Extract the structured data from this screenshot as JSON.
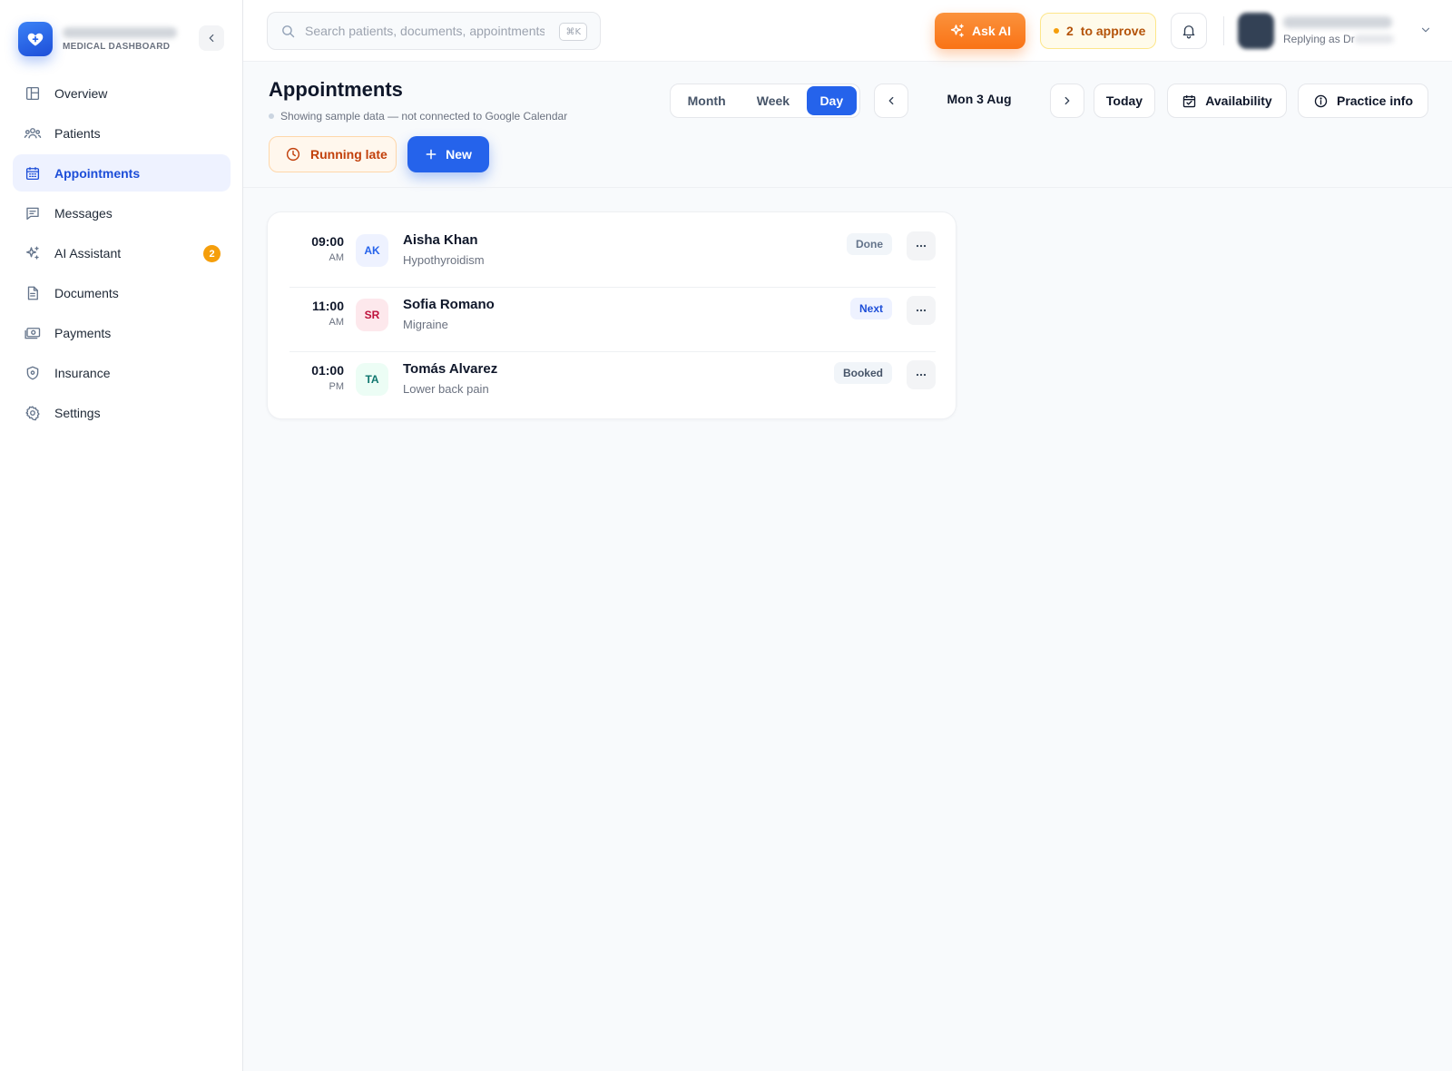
{
  "brand": {
    "subtitle": "MEDICAL DASHBOARD",
    "logo_icon": "heart-plus-icon",
    "accent": "#2563eb"
  },
  "sidebar": {
    "items": [
      {
        "label": "Overview",
        "icon": "layout-icon",
        "active": false
      },
      {
        "label": "Patients",
        "icon": "users-icon",
        "active": false
      },
      {
        "label": "Appointments",
        "icon": "calendar-icon",
        "active": true
      },
      {
        "label": "Messages",
        "icon": "message-icon",
        "active": false
      },
      {
        "label": "AI Assistant",
        "icon": "sparkles-icon",
        "active": false,
        "badge": "2"
      },
      {
        "label": "Documents",
        "icon": "document-icon",
        "active": false
      },
      {
        "label": "Payments",
        "icon": "cash-icon",
        "active": false
      },
      {
        "label": "Insurance",
        "icon": "shield-icon",
        "active": false
      },
      {
        "label": "Settings",
        "icon": "gear-icon",
        "active": false
      }
    ]
  },
  "topbar": {
    "search_placeholder": "Search patients, documents, appointments...",
    "search_shortcut": "⌘K",
    "ask_ai_label": "Ask AI",
    "approve_count": "2",
    "approve_label": "to approve",
    "replying_as": "Replying as Dr"
  },
  "page": {
    "title": "Appointments",
    "sample_note": "Showing sample data — not connected to Google Calendar",
    "running_late_label": "Running late",
    "new_label": "New",
    "views": [
      "Month",
      "Week",
      "Day"
    ],
    "active_view": "Day",
    "date_label": "Mon 3 Aug",
    "today_label": "Today",
    "availability_label": "Availability",
    "practice_info_label": "Practice info"
  },
  "appointments": [
    {
      "time": "09:00",
      "ampm": "AM",
      "initials": "AK",
      "name": "Aisha Khan",
      "condition": "Hypothyroidism",
      "status": "Done",
      "avatar_bg": "#eef2ff",
      "avatar_fg": "#2563eb",
      "status_bg": "#f1f5f9",
      "status_fg": "#64748b"
    },
    {
      "time": "11:00",
      "ampm": "AM",
      "initials": "SR",
      "name": "Sofia Romano",
      "condition": "Migraine",
      "status": "Next",
      "avatar_bg": "#fde8ec",
      "avatar_fg": "#be123c",
      "status_bg": "#eef2ff",
      "status_fg": "#1d4ed8"
    },
    {
      "time": "01:00",
      "ampm": "PM",
      "initials": "TA",
      "name": "Tomás Alvarez",
      "condition": "Lower back pain",
      "status": "Booked",
      "avatar_bg": "#ecfdf5",
      "avatar_fg": "#0f766e",
      "status_bg": "#f1f5f9",
      "status_fg": "#475569"
    }
  ]
}
